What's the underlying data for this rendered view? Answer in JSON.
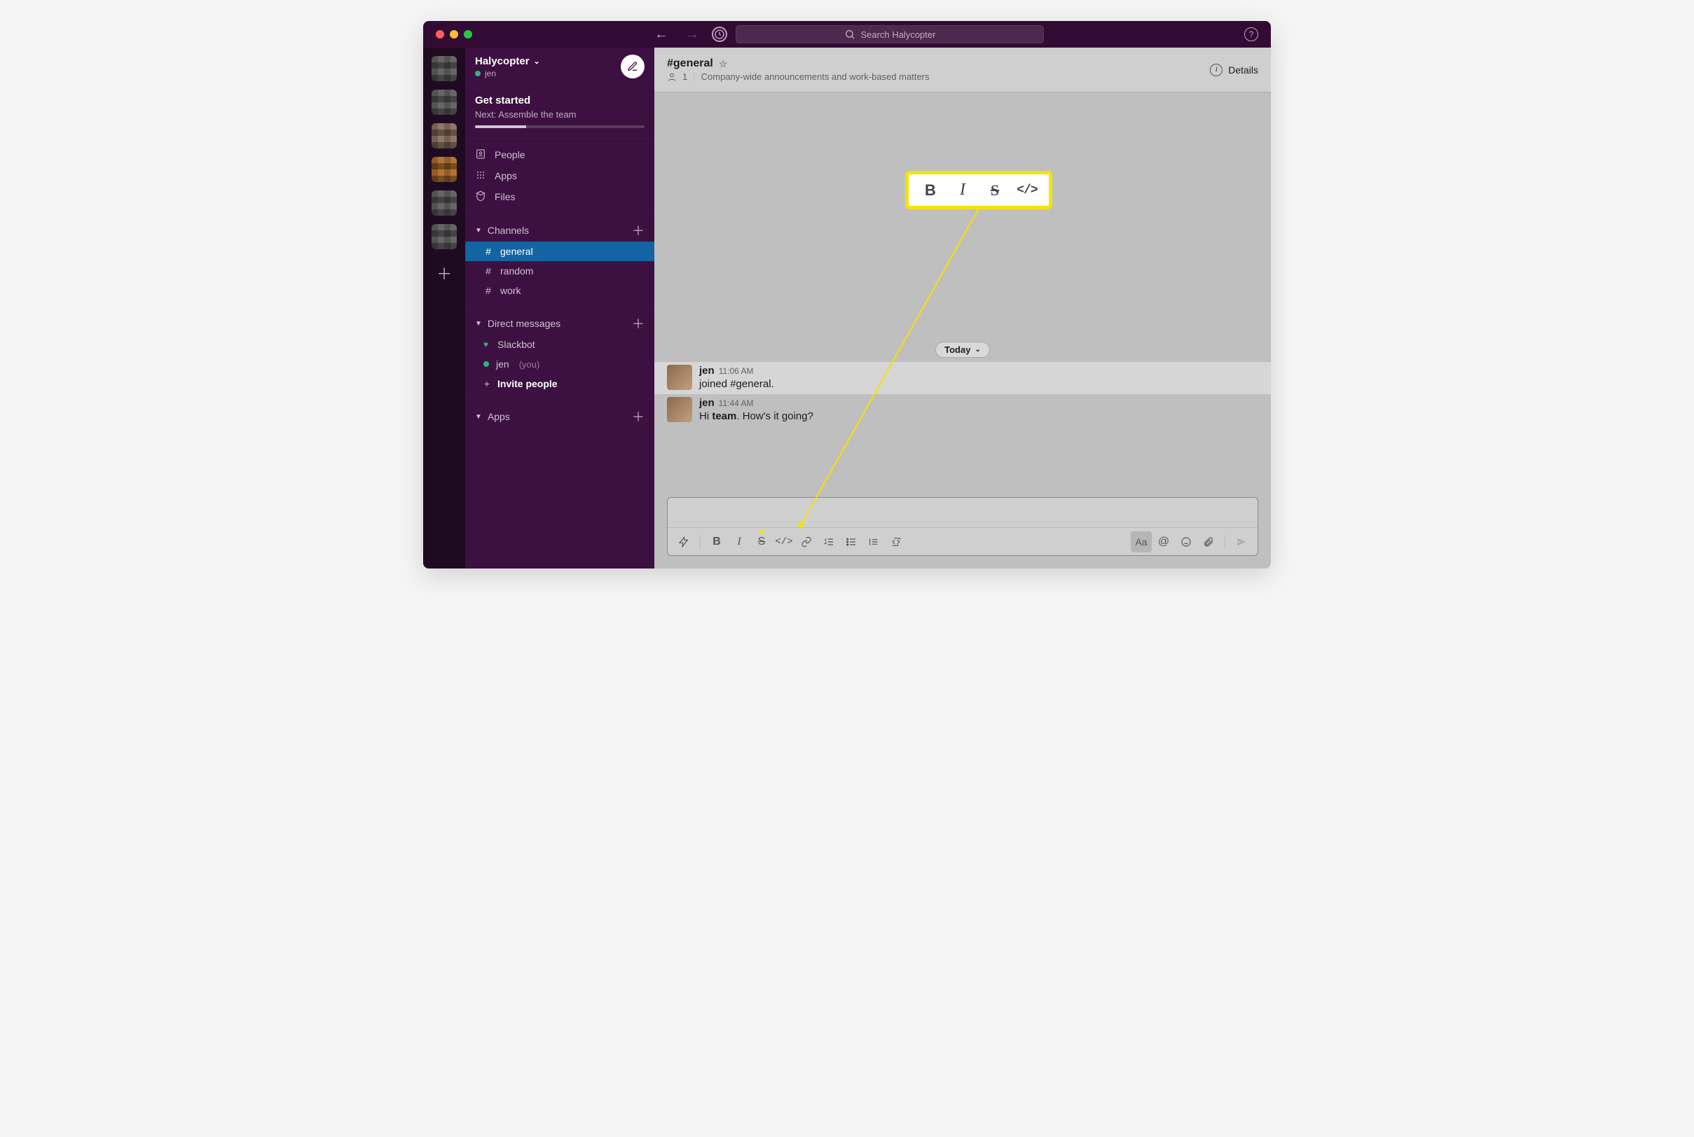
{
  "titlebar": {
    "search_placeholder": "Search Halycopter"
  },
  "workspace": {
    "name": "Halycopter",
    "user": "jen"
  },
  "get_started": {
    "title": "Get started",
    "next_label": "Next: Assemble the team",
    "progress_percent": 30
  },
  "sidebar_nav": {
    "people": "People",
    "apps": "Apps",
    "files": "Files"
  },
  "sections": {
    "channels_label": "Channels",
    "dm_label": "Direct messages",
    "apps_label": "Apps"
  },
  "channels": [
    {
      "name": "general",
      "active": true
    },
    {
      "name": "random",
      "active": false
    },
    {
      "name": "work",
      "active": false
    }
  ],
  "dms": [
    {
      "name": "Slackbot",
      "icon": "heart"
    },
    {
      "name": "jen",
      "icon": "dot",
      "you_label": "(you)"
    }
  ],
  "invite_label": "Invite people",
  "channel_header": {
    "name": "#general",
    "member_count": "1",
    "topic": "Company-wide announcements and work-based matters",
    "details_label": "Details"
  },
  "date_divider": "Today",
  "messages": [
    {
      "sender": "jen",
      "time": "11:06 AM",
      "text_parts": [
        {
          "t": "joined #general.",
          "b": false
        }
      ]
    },
    {
      "sender": "jen",
      "time": "11:44 AM",
      "text_parts": [
        {
          "t": "Hi ",
          "b": false
        },
        {
          "t": "team",
          "b": true
        },
        {
          "t": ". How's it going?",
          "b": false
        }
      ]
    }
  ],
  "composer": {
    "placeholder": "",
    "toolbar": {
      "aa_active": true
    }
  },
  "callout_icons": [
    "B",
    "I",
    "S",
    "</>"
  ]
}
